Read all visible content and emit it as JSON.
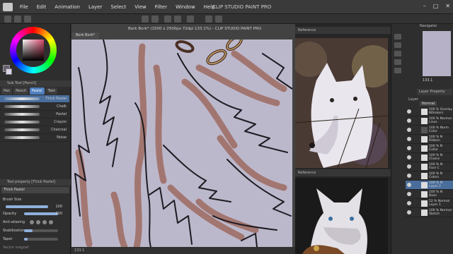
{
  "app": {
    "title": "CLIP STUDIO PAINT PRO",
    "menu": [
      "File",
      "Edit",
      "Animation",
      "Layer",
      "Select",
      "View",
      "Filter",
      "Window",
      "Help"
    ]
  },
  "left_panel": {
    "subtool_header": "Sub Tool [Pencil]",
    "tabs": [
      "Pen",
      "Pencil",
      "Pastel",
      "Twin"
    ],
    "brushes": [
      {
        "label": "Thick Pastel",
        "selected": true
      },
      {
        "label": "Chalk"
      },
      {
        "label": "Pastel"
      },
      {
        "label": "Crayon"
      },
      {
        "label": "Charcoal"
      },
      {
        "label": "Noise"
      }
    ],
    "tool_property_header": "Tool property [Thick Pastel]",
    "tool_property_title": "Thick Pastel",
    "brush_size_label": "Brush Size",
    "brush_size_value": "100",
    "opacity_label": "Opacity",
    "opacity_value": "100",
    "antialias_label": "Anti-aliasing",
    "stabilization_label": "Stabilization",
    "taper_label": "Taper",
    "vector_magnet_label": "Vector magnet"
  },
  "canvas": {
    "doc_tab": "Bork Bork*",
    "doc_title": "Bork Bork* (1500 x 2500px 72dpi 133.1%) - CLIP STUDIO PAINT PRO",
    "status": "133.1"
  },
  "reference": {
    "header1": "Reference",
    "header2": "Reference"
  },
  "right_panel": {
    "navigator_label": "Navigator",
    "zoom_value": "133.1",
    "layer_property_label": "Layer Property",
    "layer_header": "Layer",
    "blend_mode": "Normal",
    "layers": [
      {
        "name": "100 % Overlay\nWhiskers"
      },
      {
        "name": "100 % Normal\nLines"
      },
      {
        "name": "100 % Norm\nColor"
      },
      {
        "name": "100 % N\nRibbon"
      },
      {
        "name": "100 % N\nCollar"
      },
      {
        "name": "100 % N\nChains"
      },
      {
        "name": "100 % N\nFace C"
      },
      {
        "name": "100 % N\nColors"
      },
      {
        "name": "100 % N\nLayer 2",
        "selected": true
      },
      {
        "name": "100 % N\nBase"
      },
      {
        "name": "52 % Normal\nLayer 1"
      },
      {
        "name": "100 % Normal\nSketch"
      }
    ]
  },
  "colors": {
    "canvas_bg": "#bcb8cc",
    "brush_brown": "#9e6b60",
    "selection_blue": "#4a6e9c"
  }
}
